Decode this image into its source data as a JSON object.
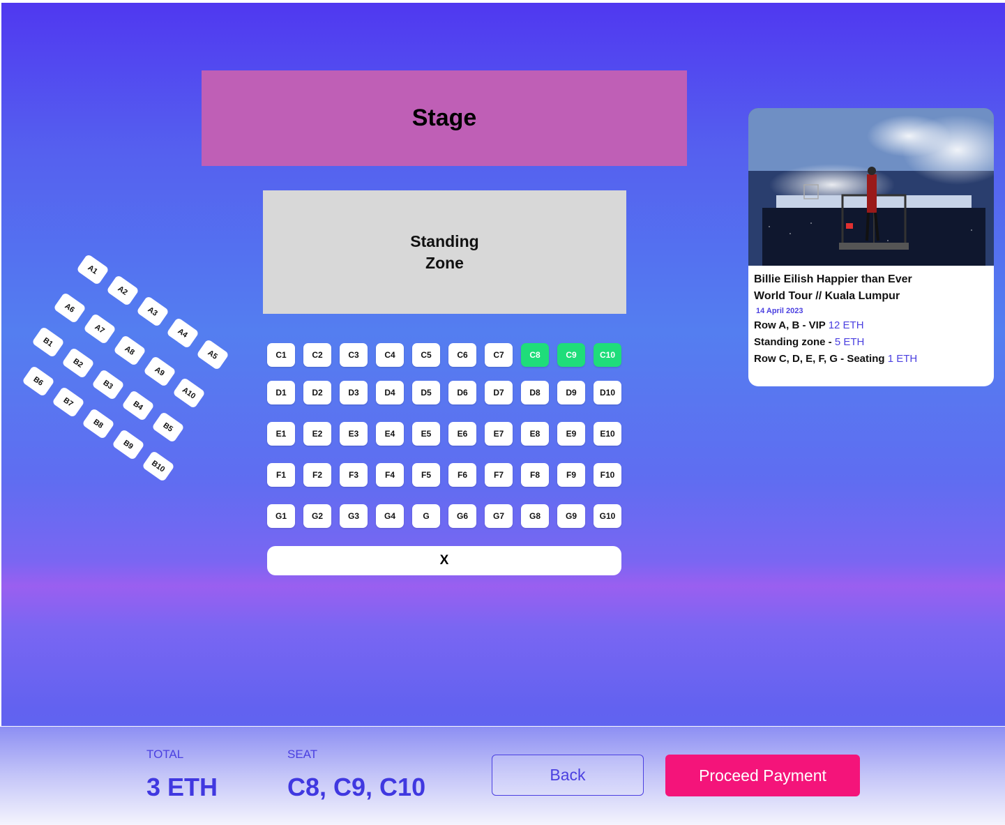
{
  "venue": {
    "stage_label": "Stage",
    "standing_label": "Standing Zone",
    "close_label": "X"
  },
  "angled_seats": [
    "A1",
    "A2",
    "A3",
    "A4",
    "A5",
    "A6",
    "A7",
    "A8",
    "A9",
    "A10",
    "B1",
    "B2",
    "B3",
    "B4",
    "B5",
    "B6",
    "B7",
    "B8",
    "B9",
    "B10"
  ],
  "grid_rows": [
    [
      "C1",
      "C2",
      "C3",
      "C4",
      "C5",
      "C6",
      "C7",
      "C8",
      "C9",
      "C10"
    ],
    [
      "D1",
      "D2",
      "D3",
      "D4",
      "D5",
      "D6",
      "D7",
      "D8",
      "D9",
      "D10"
    ],
    [
      "E1",
      "E2",
      "E3",
      "E4",
      "E5",
      "E6",
      "E7",
      "E8",
      "E9",
      "E10"
    ],
    [
      "F1",
      "F2",
      "F3",
      "F4",
      "F5",
      "F6",
      "F7",
      "F8",
      "F9",
      "F10"
    ],
    [
      "G1",
      "G2",
      "G3",
      "G4",
      "G",
      "G6",
      "G7",
      "G8",
      "G9",
      "G10"
    ]
  ],
  "selected_seats": [
    "C8",
    "C9",
    "C10"
  ],
  "colors": {
    "selected_seat": "#1fdd7a",
    "accent": "#4a3fe0",
    "pay_button": "#f4147a",
    "stage": "#bf5fb6"
  },
  "event": {
    "title_line1": "Billie Eilish Happier than Ever",
    "title_line2": "World Tour // Kuala Lumpur",
    "date": "14 April 2023",
    "pricing": [
      {
        "label": "Row A, B - VIP",
        "price": "12 ETH"
      },
      {
        "label": "Standing zone - ",
        "price": "5 ETH"
      },
      {
        "label": "Row C, D, E, F, G - Seating",
        "price": "1 ETH"
      }
    ]
  },
  "footer": {
    "total_label": "TOTAL",
    "total_value": "3 ETH",
    "seat_label": "SEAT",
    "seat_value": "C8, C9, C10",
    "back_label": "Back",
    "pay_label": "Proceed Payment"
  }
}
